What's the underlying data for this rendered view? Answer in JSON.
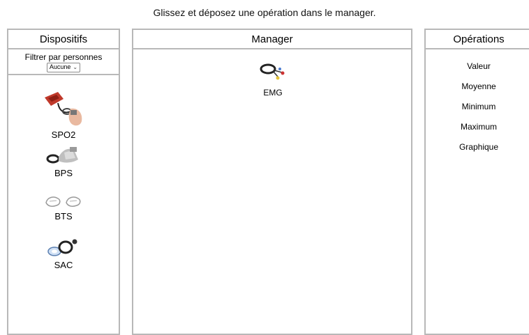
{
  "instruction": "Glissez et déposez une opération dans le manager.",
  "devices_panel": {
    "title": "Dispositifs",
    "filter_label": "Filtrer par personnes",
    "filter_value": "Aucune",
    "devices": [
      {
        "label": "SPO2",
        "icon": "pulse-oximeter-icon"
      },
      {
        "label": "BPS",
        "icon": "blood-pressure-cuff-icon"
      },
      {
        "label": "BTS",
        "icon": "body-temperature-sensor-icon"
      },
      {
        "label": "SAC",
        "icon": "airflow-sensor-icon"
      }
    ]
  },
  "manager_panel": {
    "title": "Manager",
    "items": [
      {
        "label": "EMG",
        "icon": "emg-electrodes-icon"
      }
    ]
  },
  "operations_panel": {
    "title": "Opérations",
    "operations": [
      "Valeur",
      "Moyenne",
      "Minimum",
      "Maximum",
      "Graphique"
    ]
  }
}
